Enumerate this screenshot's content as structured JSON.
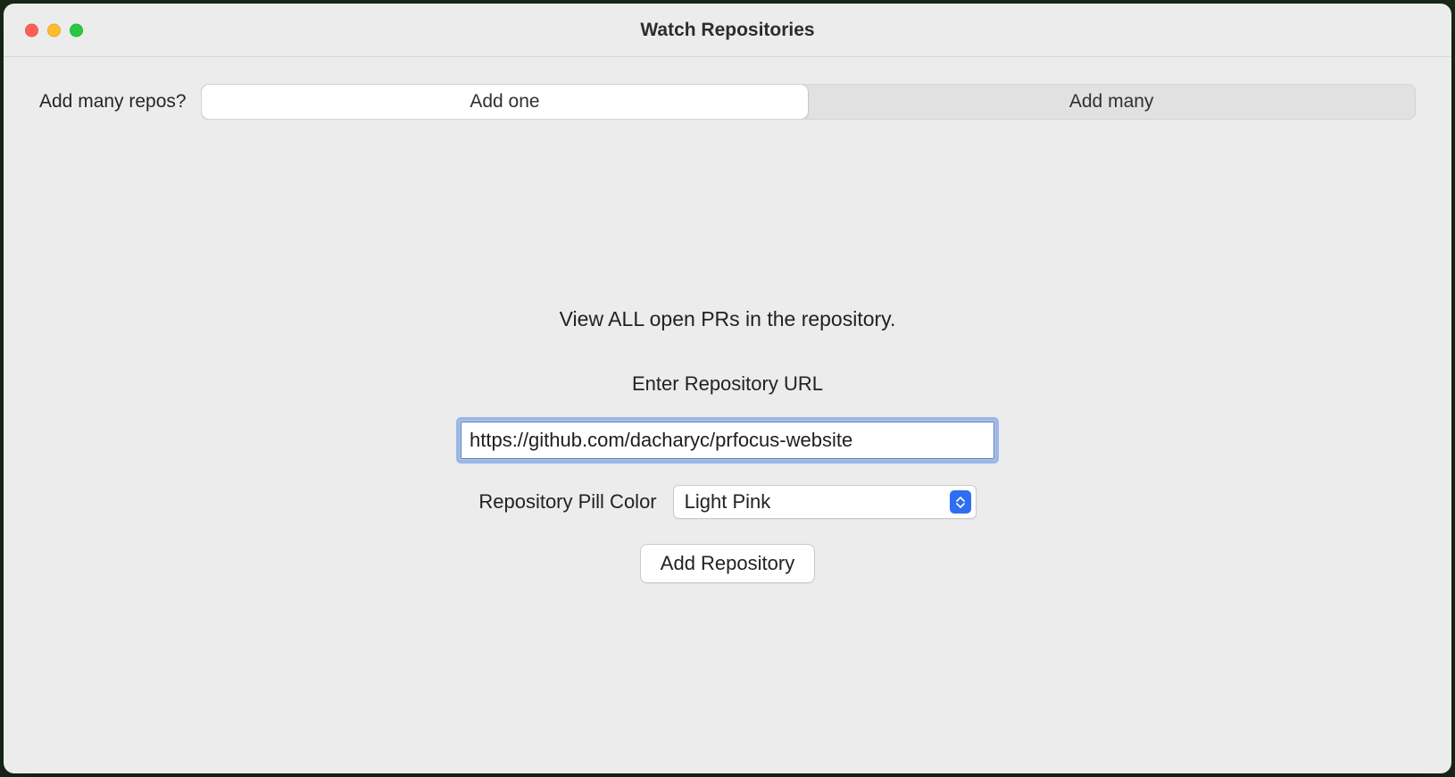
{
  "window": {
    "title": "Watch Repositories"
  },
  "segmented": {
    "label": "Add many repos?",
    "options": {
      "one": "Add one",
      "many": "Add many"
    },
    "selected": "one"
  },
  "form": {
    "description": "View ALL open PRs in the repository.",
    "url_label": "Enter Repository URL",
    "url_value": "https://github.com/dacharyc/prfocus-website",
    "pill_label": "Repository Pill Color",
    "pill_value": "Light Pink",
    "submit_label": "Add Repository"
  }
}
